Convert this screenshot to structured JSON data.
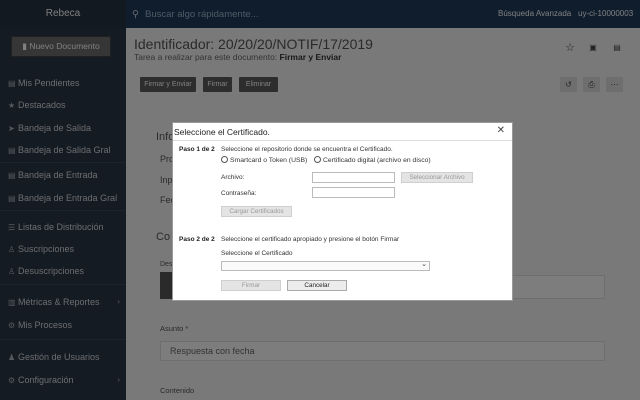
{
  "topbar": {
    "brand": "Rebeca",
    "search_placeholder": "Buscar algo rápidamente...",
    "advanced_search": "Búsqueda Avanzada",
    "user": "uy-ci-10000003"
  },
  "sidebar": {
    "new_document": "Nuevo Documento",
    "items": [
      {
        "label": "Mis Pendientes",
        "icon": "inbox-icon"
      },
      {
        "label": "Destacados",
        "icon": "star-icon"
      },
      {
        "label": "Bandeja de Salida",
        "icon": "send-icon"
      },
      {
        "label": "Bandeja de Salida Gral",
        "icon": "send-icon"
      },
      {
        "label": "Bandeja de Entrada",
        "icon": "inbox-icon"
      },
      {
        "label": "Bandeja de Entrada Gral",
        "icon": "inbox-icon"
      },
      {
        "label": "Listas de Distribución",
        "icon": "list-icon"
      },
      {
        "label": "Suscripciones",
        "icon": "user-plus-icon"
      },
      {
        "label": "Desuscripciones",
        "icon": "user-minus-icon"
      },
      {
        "label": "Métricas & Reportes",
        "icon": "chart-icon"
      },
      {
        "label": "Mis Procesos",
        "icon": "gear-icon"
      },
      {
        "label": "Gestión de Usuarios",
        "icon": "users-icon"
      },
      {
        "label": "Configuración",
        "icon": "gear-icon"
      }
    ]
  },
  "main": {
    "title": "Identificador: 20/20/20/NOTIF/17/2019",
    "subtitle_prefix": "Tarea a realizar para este documento:",
    "subtitle_task": "Firmar y Enviar",
    "buttons": {
      "sign_send": "Firmar y Enviar",
      "sign": "Firmar",
      "delete": "Eliminar"
    },
    "section_info_partial": "Infor",
    "field_p_partial": "Pro",
    "field_i_partial": "Inp",
    "field_f_partial": "Fec",
    "section_c_partial": "Co",
    "field_d_partial": "Des",
    "asunto_label": "Asunto *",
    "asunto_value": "Respuesta con fecha",
    "contenido_label": "Contenido"
  },
  "modal": {
    "title": "Seleccione el Certificado.",
    "close": "✕",
    "step1_label": "Paso 1 de 2",
    "step1_text": "Seleccione el repositorio donde se encuentra el Certificado.",
    "radio_smartcard": "Smartcard o Token (USB)",
    "radio_digital": "Certificado digital (archivo en disco)",
    "archivo_label": "Archivo:",
    "contrasena_label": "Contraseña:",
    "select_file_button": "Seleccionar Archivo",
    "load_certs_button": "Cargar Certificados",
    "step2_label": "Paso 2 de 2",
    "step2_text": "Seleccione el certificado apropiado y presione el botón Firmar",
    "select_cert_label": "Seleccione el Certificado",
    "sign_button": "Firmar",
    "cancel_button": "Cancelar"
  }
}
